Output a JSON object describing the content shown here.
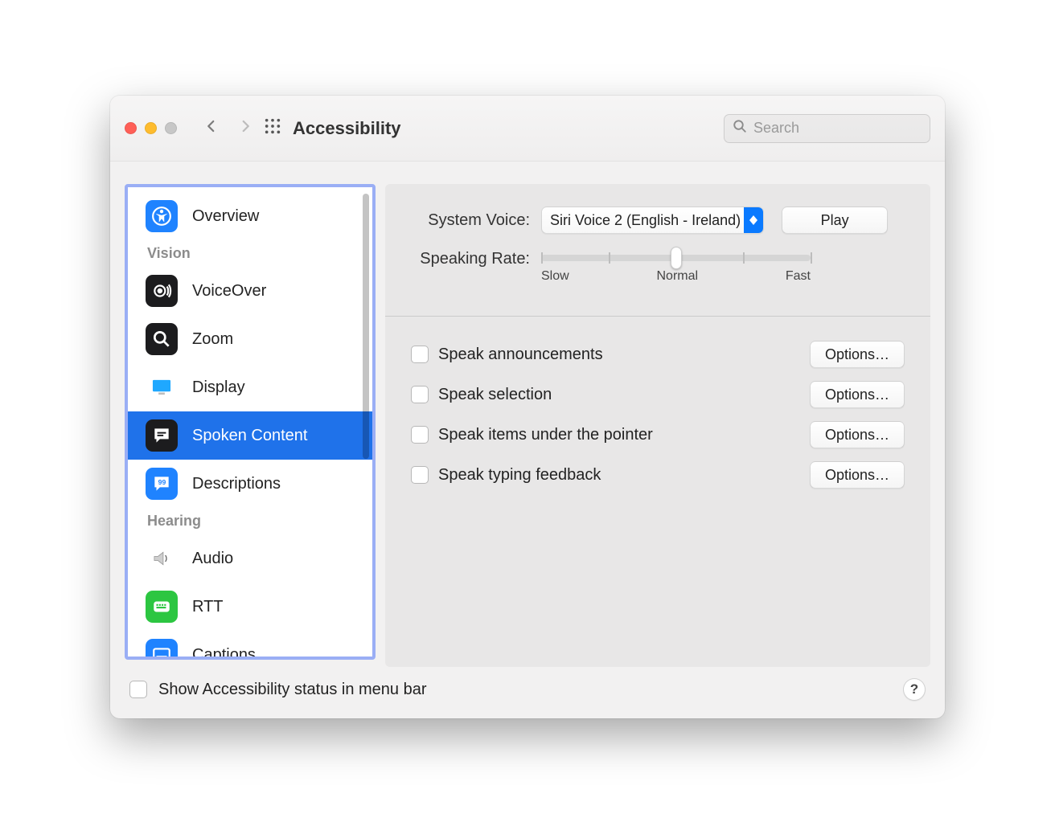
{
  "window": {
    "title": "Accessibility",
    "search_placeholder": "Search"
  },
  "sidebar": {
    "items": {
      "overview": "Overview",
      "voiceover": "VoiceOver",
      "zoom": "Zoom",
      "display": "Display",
      "spoken": "Spoken Content",
      "descriptions": "Descriptions",
      "audio": "Audio",
      "rtt": "RTT",
      "captions": "Captions"
    },
    "sections": {
      "vision": "Vision",
      "hearing": "Hearing"
    }
  },
  "content": {
    "system_voice_label": "System Voice:",
    "system_voice_value": "Siri Voice 2 (English - Ireland)",
    "play_button": "Play",
    "speaking_rate_label": "Speaking Rate:",
    "slider": {
      "slow": "Slow",
      "normal": "Normal",
      "fast": "Fast"
    },
    "options_button": "Options…",
    "checks": {
      "announcements": "Speak announcements",
      "selection": "Speak selection",
      "pointer": "Speak items under the pointer",
      "typing": "Speak typing feedback"
    }
  },
  "footer": {
    "menubar_label": "Show Accessibility status in menu bar",
    "help": "?"
  }
}
